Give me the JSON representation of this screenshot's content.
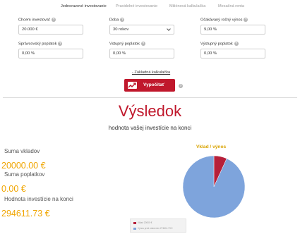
{
  "tabs": [
    {
      "label": "Jednorazové investovanie",
      "active": true
    },
    {
      "label": "Pravidelné investovanie",
      "active": false
    },
    {
      "label": "Miliónová kalkulačka",
      "active": false
    },
    {
      "label": "Mesačná renta",
      "active": false
    }
  ],
  "form": {
    "invest": {
      "label": "Chcem investovať",
      "value": "20.000 €"
    },
    "duration": {
      "label": "Doba",
      "value": "30 rokov"
    },
    "expected_return": {
      "label": "Očakávaný ročný výnos",
      "value": "9,00 %"
    },
    "management_fee": {
      "label": "Správcovský poplatok",
      "value": "0,00 %"
    },
    "entry_fee": {
      "label": "Vstupný poplatok",
      "value": "0,00 %"
    },
    "exit_fee": {
      "label": "Výstupný poplatok",
      "value": "0,00 %"
    }
  },
  "basic_calc_link": "- Základná kalkulačka",
  "calculate_button": "Vypočítať",
  "result": {
    "title": "Výsledok",
    "subtitle": "hodnota vašej investície na konci",
    "deposits_label": "Suma vkladov",
    "deposits_value": "20000.00 €",
    "fees_label": "Suma poplatkov",
    "fees_value": "0.00 €",
    "end_value_label": "Hodnota investície na konci",
    "end_value": "294611.73 €"
  },
  "chart_data": {
    "type": "pie",
    "title": "Vklad / výnos",
    "legend_position": "bottom",
    "series": [
      {
        "name": "Vklad 20000 €",
        "value": 20000.0,
        "color": "#b6203a"
      },
      {
        "name": "Výnos pred zdanením 274611.73 €",
        "value": 274611.73,
        "color": "#7ea4dc"
      }
    ]
  }
}
